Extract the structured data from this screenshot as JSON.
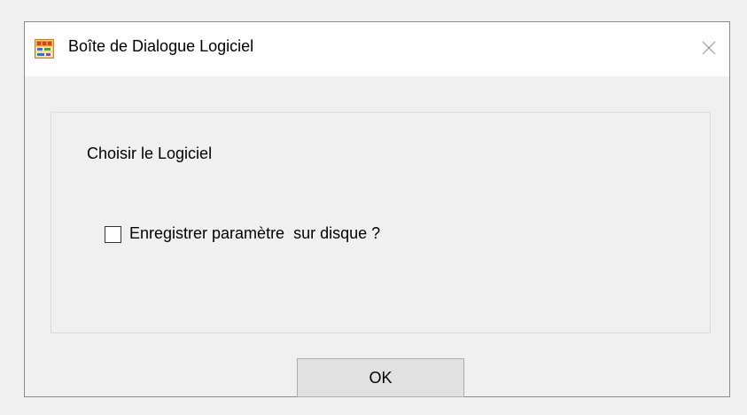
{
  "window": {
    "title": "Boîte de Dialogue Logiciel",
    "app_icon": "java-app-icon",
    "close_icon": "close-icon"
  },
  "group": {
    "label": "Choisir le Logiciel"
  },
  "checkbox": {
    "label": "Enregistrer paramètre  sur disque ?",
    "checked": false
  },
  "buttons": {
    "ok_label": "OK"
  },
  "colors": {
    "titlebar_bg": "#ffffff",
    "dialog_bg": "#f0f0f0",
    "button_bg": "#e1e1e1",
    "button_border": "#adadad"
  }
}
